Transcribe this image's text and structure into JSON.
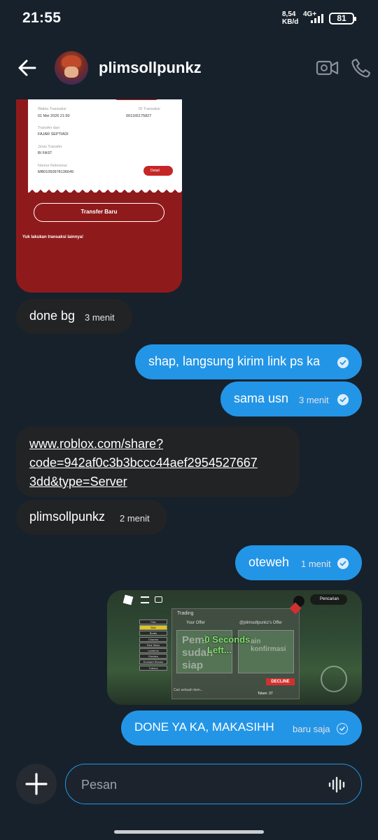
{
  "status_bar": {
    "time": "21:55",
    "net_speed": "8,54",
    "net_unit": "KB/d",
    "network": "4G+",
    "battery": "81"
  },
  "header": {
    "contact_name": "plimsollpunkz",
    "icons": [
      "back-arrow-icon",
      "video-call-icon",
      "phone-icon"
    ]
  },
  "receipt": {
    "waktu_label": "Waktu Transaksi",
    "waktu_value": "01 Mei 2026 21:50",
    "id_label": "ID Transaksi",
    "id_value": "001165175827",
    "from_label": "Transfer dari",
    "from_value": "FAJAR SEPTIADI",
    "type_label": "Jenis Transfer",
    "type_value": "BI FAST",
    "ref_label": "Nomor Referensi",
    "ref_value": "MB01050978136649",
    "detail_button": "Detail",
    "transfer_button": "Transfer Baru",
    "more_text": "Yuk lakukan transaksi lainnya!"
  },
  "messages": [
    {
      "direction": "in",
      "text": "done bg",
      "time": "3 menit"
    },
    {
      "direction": "out",
      "text": "shap, langsung kirim link ps ka",
      "time": "",
      "read": true
    },
    {
      "direction": "out",
      "text": "sama usn",
      "time": "3 menit",
      "read": true
    },
    {
      "direction": "in",
      "text": "www.roblox.com/share?code=942af0c3b3bccc44aef29545276673dd&type=Server",
      "line1": "www.roblox.com/share?",
      "line2": "code=942af0c3b3bccc44aef2954527667",
      "line3": "3dd&type=Server",
      "time": ""
    },
    {
      "direction": "in",
      "text": "plimsollpunkz",
      "time": "2 menit"
    },
    {
      "direction": "out",
      "text": "oteweh",
      "time": "1 menit",
      "read": true
    },
    {
      "direction": "out",
      "text": "DONE YA KA, MAKASIHH",
      "time": "baru saja",
      "read": false
    }
  ],
  "game_screenshot": {
    "trading_title": "Trading",
    "your_offer": "Your Offer",
    "their_offer": "@plimsollpunkz's Offer",
    "countdown_line1": "-0 Seconds",
    "countdown_line2": "Left...",
    "ghost_text": "Pemi sudah siap",
    "ghost_text_right": "ain konfirmasi",
    "decline": "DECLINE",
    "search_button": "Pencarian",
    "token_label": "Token:",
    "token_value": "37",
    "search_items": "Cari sebuah item...",
    "side_menu": [
      "Fish",
      "Bait",
      "Boats",
      "Charms",
      "Rod Skins",
      "Lanterns",
      "Emotes",
      "Enchant Stones",
      "Totems"
    ]
  },
  "composer": {
    "placeholder": "Pesan"
  },
  "colors": {
    "background": "#17212b",
    "incoming_bubble": "#222325",
    "outgoing_bubble": "#2395e7",
    "accent": "#2395e7"
  }
}
